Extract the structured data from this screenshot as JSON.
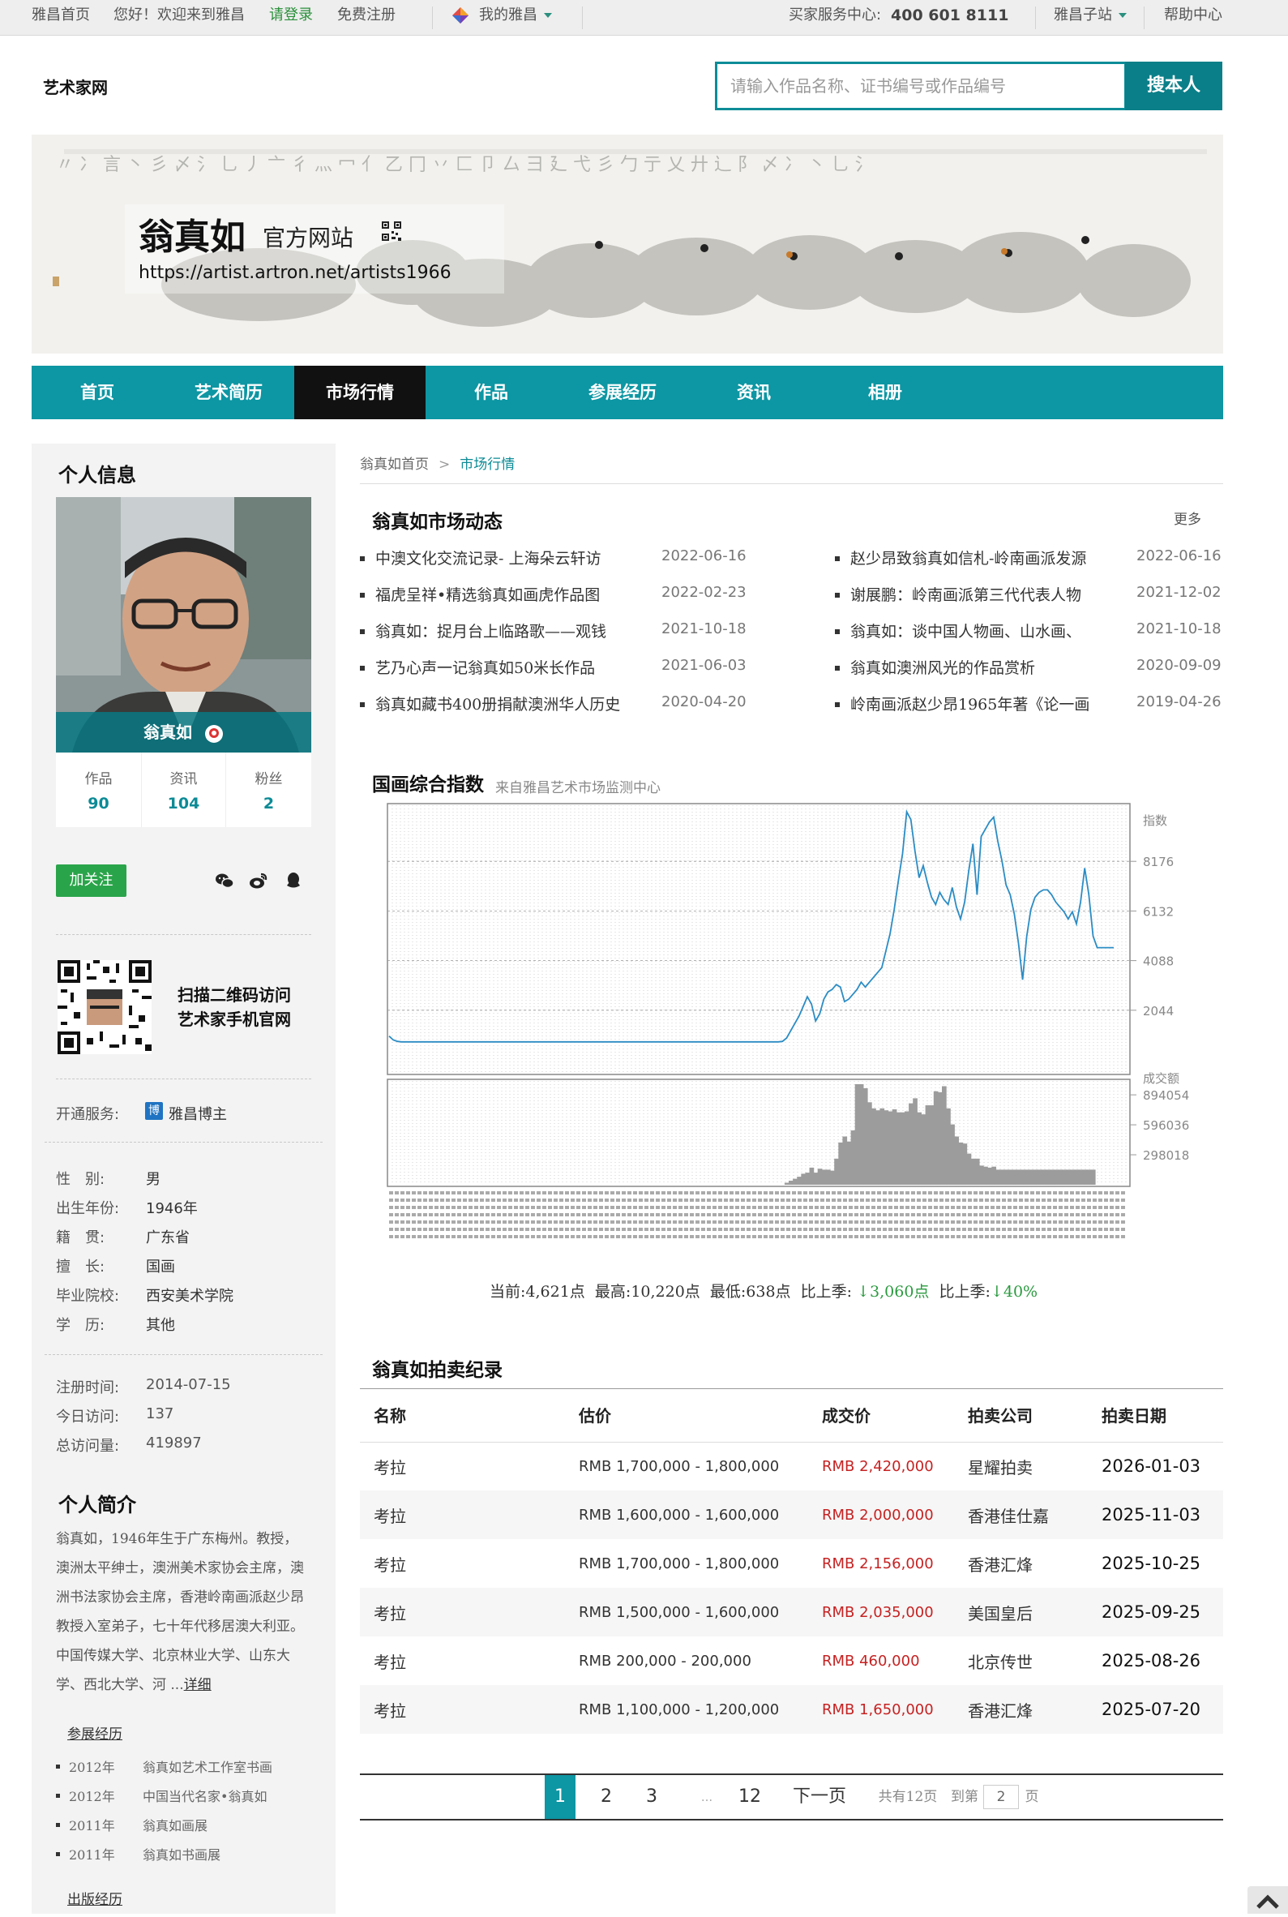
{
  "topbar": {
    "home": "雅昌首页",
    "welcome": "您好！欢迎来到雅昌",
    "login": "请登录",
    "register": "免费注册",
    "my_artron": "我的雅昌",
    "buyer_service": "买家服务中心:",
    "phone": "400 601 8111",
    "sub_sites": "雅昌子站",
    "help": "帮助中心"
  },
  "header": {
    "site_name": "艺术家网",
    "search_placeholder": "请输入作品名称、证书编号或作品编号",
    "search_button": "搜本人"
  },
  "banner": {
    "artist_name": "翁真如",
    "official_site": "官方网站",
    "url": "https://artist.artron.net/artists1966"
  },
  "nav": [
    "首页",
    "艺术简历",
    "市场行情",
    "作品",
    "参展经历",
    "资讯",
    "相册"
  ],
  "sidebar": {
    "personal_info_title": "个人信息",
    "avatar_name": "翁真如",
    "stats": [
      {
        "label": "作品",
        "value": "90"
      },
      {
        "label": "资讯",
        "value": "104"
      },
      {
        "label": "粉丝",
        "value": "2"
      }
    ],
    "follow": "加关注",
    "qr_line1": "扫描二维码访问",
    "qr_line2": "艺术家手机官网",
    "service_label": "开通服务:",
    "service_icon": "博",
    "service_value": "雅昌博主",
    "info": [
      {
        "label": "性　别:",
        "value": "男"
      },
      {
        "label": "出生年份:",
        "value": "1946年"
      },
      {
        "label": "籍　贯:",
        "value": "广东省"
      },
      {
        "label": "擅　长:",
        "value": "国画"
      },
      {
        "label": "毕业院校:",
        "value": "西安美术学院"
      },
      {
        "label": "学　历:",
        "value": "其他"
      }
    ],
    "visits": [
      {
        "label": "注册时间:",
        "value": "2014-07-15"
      },
      {
        "label": "今日访问:",
        "value": "137"
      },
      {
        "label": "总访问量:",
        "value": "419897"
      }
    ],
    "intro_title": "个人简介",
    "intro_text": "翁真如，1946年生于广东梅州。教授，澳洲太平绅士，澳洲美术家协会主席，澳洲书法家协会主席，香港岭南画派赵少昂教授入室弟子，七十年代移居澳大利亚。中国传媒大学、北京林业大学、山东大学、西北大学、河 ...",
    "intro_more": "详细",
    "exhibition_title": "参展经历",
    "exhibitions": [
      {
        "year": "2012年",
        "title": "翁真如艺术工作室书画"
      },
      {
        "year": "2012年",
        "title": "中国当代名家•翁真如"
      },
      {
        "year": "2011年",
        "title": "翁真如画展"
      },
      {
        "year": "2011年",
        "title": "翁真如书画展"
      }
    ],
    "publication_title": "出版经历"
  },
  "breadcrumb": {
    "home": "翁真如首页",
    "sep": ">",
    "current": "市场行情"
  },
  "news": {
    "title": "翁真如市场动态",
    "more": "更多",
    "items": [
      {
        "title": "中澳文化交流记录- 上海朵云轩访",
        "date": "2022-06-16"
      },
      {
        "title": "赵少昂致翁真如信札-岭南画派发源",
        "date": "2022-06-16"
      },
      {
        "title": "福虎呈祥•精选翁真如画虎作品图",
        "date": "2022-02-23"
      },
      {
        "title": "谢展鹏：岭南画派第三代代表人物",
        "date": "2021-12-02"
      },
      {
        "title": "翁真如：捉月台上临路歌——观钱",
        "date": "2021-10-18"
      },
      {
        "title": "翁真如：谈中国人物画、山水画、",
        "date": "2021-10-18"
      },
      {
        "title": "艺乃心声一记翁真如50米长作品",
        "date": "2021-06-03"
      },
      {
        "title": "翁真如澳洲风光的作品赏析",
        "date": "2020-09-09"
      },
      {
        "title": "翁真如藏书400册捐献澳洲华人历史",
        "date": "2020-04-20"
      },
      {
        "title": "岭南画派赵少昂1965年著《论一画",
        "date": "2019-04-26"
      }
    ]
  },
  "index": {
    "title": "国画综合指数",
    "source": "来自雅昌艺术市场监测中心",
    "summary": {
      "current_label": "当前:",
      "current": "4,621点",
      "high_label": "最高:",
      "high": "10,220点",
      "low_label": "最低:",
      "low": "638点",
      "qoq_label": "比上季:",
      "qoq_value": "↓3,060点",
      "qoq_label2": "比上季:",
      "qoq_pct": "↓40%"
    }
  },
  "chart_data": {
    "type": "line",
    "series": [
      {
        "name": "指数",
        "values": [
          980,
          820,
          760,
          740,
          740,
          740,
          740,
          740,
          740,
          740,
          740,
          740,
          740,
          740,
          740,
          740,
          740,
          740,
          740,
          740,
          740,
          740,
          740,
          740,
          740,
          740,
          740,
          740,
          740,
          740,
          740,
          740,
          740,
          740,
          740,
          740,
          740,
          740,
          740,
          740,
          740,
          740,
          740,
          740,
          740,
          740,
          740,
          740,
          740,
          740,
          740,
          740,
          740,
          740,
          740,
          740,
          740,
          740,
          740,
          740,
          740,
          740,
          740,
          740,
          740,
          740,
          740,
          740,
          740,
          740,
          740,
          740,
          740,
          740,
          740,
          740,
          740,
          740,
          740,
          740,
          740,
          740,
          740,
          740,
          740,
          740,
          740,
          740,
          740,
          740,
          740,
          740,
          740,
          740,
          740,
          760,
          900,
          1200,
          1500,
          1800,
          2200,
          2600,
          2300,
          1600,
          1900,
          2500,
          2800,
          2900,
          3100,
          3000,
          2400,
          2500,
          2700,
          2900,
          3200,
          3000,
          3200,
          3400,
          3600,
          3800,
          4500,
          5200,
          6200,
          7400,
          8500,
          10220,
          9900,
          8600,
          7500,
          8000,
          7300,
          6700,
          6400,
          6900,
          6600,
          6400,
          7100,
          6300,
          5800,
          6500,
          7800,
          8900,
          6800,
          9200,
          9500,
          9800,
          10000,
          9000,
          8200,
          7200,
          6800,
          6000,
          4800,
          3300,
          5100,
          6200,
          6700,
          6900,
          7000,
          7000,
          6800,
          6500,
          6300,
          6100,
          5800,
          6100,
          5600,
          6500,
          7900,
          6800,
          5100,
          4621,
          4621,
          4621,
          4621,
          4621
        ],
        "volume": [
          0,
          0,
          0,
          0,
          0,
          0,
          0,
          0,
          0,
          0,
          0,
          0,
          0,
          0,
          0,
          0,
          0,
          0,
          0,
          0,
          0,
          0,
          0,
          0,
          0,
          0,
          0,
          0,
          0,
          0,
          0,
          0,
          0,
          0,
          0,
          0,
          0,
          0,
          0,
          0,
          0,
          0,
          0,
          0,
          0,
          0,
          0,
          0,
          0,
          0,
          0,
          0,
          0,
          0,
          0,
          0,
          0,
          0,
          0,
          0,
          0,
          0,
          0,
          0,
          0,
          0,
          0,
          0,
          0,
          0,
          0,
          0,
          0,
          0,
          0,
          0,
          0,
          0,
          0,
          0,
          0,
          0,
          0,
          0,
          0,
          0,
          0,
          0,
          0,
          0,
          0,
          0,
          0,
          0,
          0,
          0,
          20000,
          40000,
          60000,
          80000,
          110000,
          120000,
          170000,
          120000,
          160000,
          150000,
          150000,
          140000,
          260000,
          420000,
          480000,
          430000,
          540000,
          1000000,
          1000000,
          960000,
          820000,
          760000,
          740000,
          760000,
          740000,
          730000,
          750000,
          720000,
          720000,
          730000,
          810000,
          860000,
          720000,
          700000,
          790000,
          790000,
          930000,
          920000,
          980000,
          760000,
          600000,
          480000,
          420000,
          410000,
          310000,
          260000,
          260000,
          190000,
          180000,
          170000,
          180000,
          150000,
          150000,
          150000,
          150000,
          150000,
          150000,
          150000,
          150000,
          150000,
          150000,
          150000,
          150000,
          150000,
          150000,
          150000,
          150000,
          150000,
          150000,
          150000,
          150000,
          150000,
          150000,
          150000,
          150000
        ]
      }
    ],
    "y_label": "指数",
    "y_ticks": [
      2044,
      4088,
      6132,
      8176
    ],
    "ylim": [
      0,
      10220
    ],
    "volume_label": "成交额",
    "volume_ticks": [
      298018,
      596036,
      894054
    ],
    "volume_lim": [
      0,
      1000000
    ],
    "grid": true
  },
  "auction": {
    "title": "翁真如拍卖纪录",
    "headers": [
      "名称",
      "估价",
      "成交价",
      "拍卖公司",
      "拍卖日期"
    ],
    "rows": [
      [
        "考拉",
        "RMB 1,700,000 - 1,800,000",
        "RMB 2,420,000",
        "星耀拍卖",
        "2026-01-03"
      ],
      [
        "考拉",
        "RMB 1,600,000 - 1,600,000",
        "RMB 2,000,000",
        "香港佳仕嘉",
        "2025-11-03"
      ],
      [
        "考拉",
        "RMB 1,700,000 - 1,800,000",
        "RMB 2,156,000",
        "香港汇烽",
        "2025-10-25"
      ],
      [
        "考拉",
        "RMB 1,500,000 - 1,600,000",
        "RMB 2,035,000",
        "美国皇后",
        "2025-09-25"
      ],
      [
        "考拉",
        "RMB 200,000 - 200,000",
        "RMB 460,000",
        "北京传世",
        "2025-08-26"
      ],
      [
        "考拉",
        "RMB 1,100,000 - 1,200,000",
        "RMB 1,650,000",
        "香港汇烽",
        "2025-07-20"
      ]
    ]
  },
  "pager": {
    "pages": [
      "1",
      "2",
      "3"
    ],
    "ellipsis": "...",
    "last": "12",
    "next": "下一页",
    "total_text": "共有12页",
    "goto_label": "到第",
    "goto_value": "2",
    "page_unit": "页"
  },
  "colors": {
    "accent": "#0d96a3",
    "price": "#c62222",
    "follow": "#2aa44a",
    "chart_line": "#2b8cc4"
  }
}
